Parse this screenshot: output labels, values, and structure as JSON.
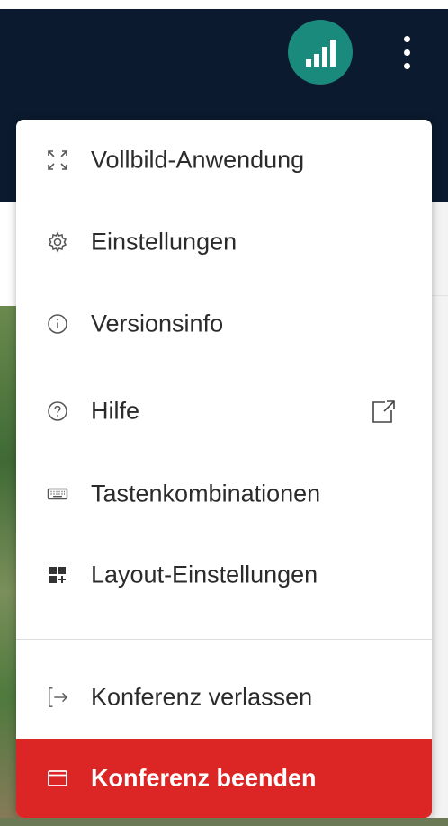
{
  "header": {
    "connection_icon": "signal-bars-icon",
    "more_icon": "more-vertical-icon"
  },
  "menu": {
    "items": [
      {
        "label": "Vollbild-Anwendung",
        "icon": "fullscreen-icon"
      },
      {
        "label": "Einstellungen",
        "icon": "gear-icon"
      },
      {
        "label": "Versionsinfo",
        "icon": "info-icon"
      },
      {
        "label": "Hilfe",
        "icon": "help-icon",
        "trailing_icon": "external-link-icon"
      },
      {
        "label": "Tastenkombinationen",
        "icon": "keyboard-icon"
      },
      {
        "label": "Layout-Einstellungen",
        "icon": "layout-icon"
      }
    ],
    "leave": {
      "label": "Konferenz verlassen",
      "icon": "exit-icon"
    },
    "end": {
      "label": "Konferenz beenden",
      "icon": "window-icon",
      "color": "#dc2626"
    }
  },
  "colors": {
    "header_bg": "#0b1a2e",
    "connection_bg": "#1a8a7d",
    "danger": "#dc2626"
  }
}
